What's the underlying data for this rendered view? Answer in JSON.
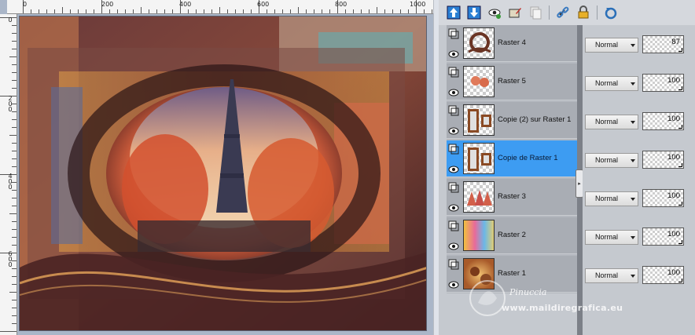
{
  "ruler_top_labels": [
    "0",
    "200",
    "400",
    "600",
    "800",
    "1000"
  ],
  "ruler_left_labels": [
    "0",
    "2\n0\n0",
    "4\n0\n0",
    "6\n0\n0"
  ],
  "toolbar": {
    "icons": [
      "move-layer-up-icon",
      "move-layer-down-icon",
      "visibility-icon",
      "edit-layer-icon",
      "duplicate-icon",
      "link-icon",
      "lock-icon",
      "refresh-icon"
    ]
  },
  "layers": [
    {
      "name": "Raster 4",
      "blend": "Normal",
      "opacity": "87",
      "selected": false,
      "thumb": "frame"
    },
    {
      "name": "Raster 5",
      "blend": "Normal",
      "opacity": "100",
      "selected": false,
      "thumb": "birds"
    },
    {
      "name": "Copie (2) sur Raster 1",
      "blend": "Normal",
      "opacity": "100",
      "selected": false,
      "thumb": "squares"
    },
    {
      "name": "Copie de Raster 1",
      "blend": "Normal",
      "opacity": "100",
      "selected": true,
      "thumb": "squares"
    },
    {
      "name": "Raster 3",
      "blend": "Normal",
      "opacity": "100",
      "selected": false,
      "thumb": "trees"
    },
    {
      "name": "Raster 2",
      "blend": "Normal",
      "opacity": "100",
      "selected": false,
      "thumb": "gradient"
    },
    {
      "name": "Raster 1",
      "blend": "Normal",
      "opacity": "100",
      "selected": false,
      "thumb": "gold"
    }
  ],
  "watermark": {
    "name": "Pinuccia",
    "url": "www.maildiregrafica.eu"
  }
}
